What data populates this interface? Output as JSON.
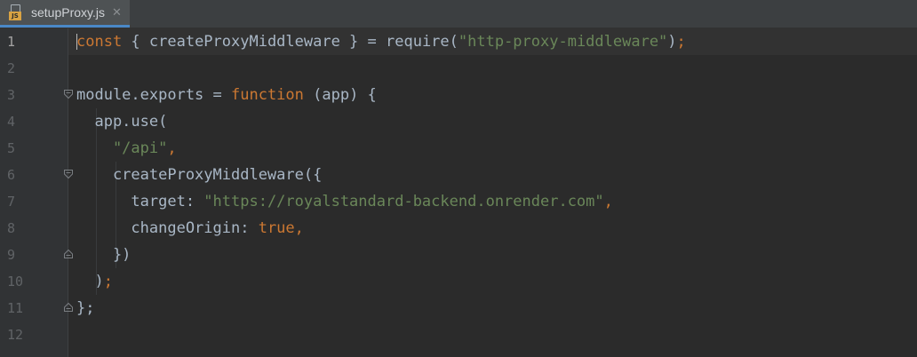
{
  "tab": {
    "file_name": "setupProxy.js",
    "icon_badge": "JS"
  },
  "line_numbers": [
    "1",
    "2",
    "3",
    "4",
    "5",
    "6",
    "7",
    "8",
    "9",
    "10",
    "11",
    "12"
  ],
  "code": {
    "l1": {
      "kw": "const",
      "a": " { createProxyMiddleware } = require(",
      "str": "\"http-proxy-middleware\"",
      "b": ")",
      "semi": ";"
    },
    "l3": {
      "a": "module.exports = ",
      "kw": "function",
      "b": " (app) {"
    },
    "l4": {
      "a": "  app.use("
    },
    "l5": {
      "str": "    \"/api\"",
      "comma": ","
    },
    "l6": {
      "a": "    createProxyMiddleware({"
    },
    "l7": {
      "a": "      target: ",
      "str": "\"https://royalstandard-backend.onrender.com\"",
      "comma": ","
    },
    "l8": {
      "a": "      changeOrigin: ",
      "kw": "true",
      "comma": ","
    },
    "l9": {
      "a": "    })"
    },
    "l10": {
      "a": "  )",
      "semi": ";"
    },
    "l11": {
      "a": "};"
    }
  },
  "colors": {
    "keyword": "#cc7832",
    "string": "#6a8759",
    "text": "#a9b7c6",
    "background": "#2b2b2b"
  }
}
